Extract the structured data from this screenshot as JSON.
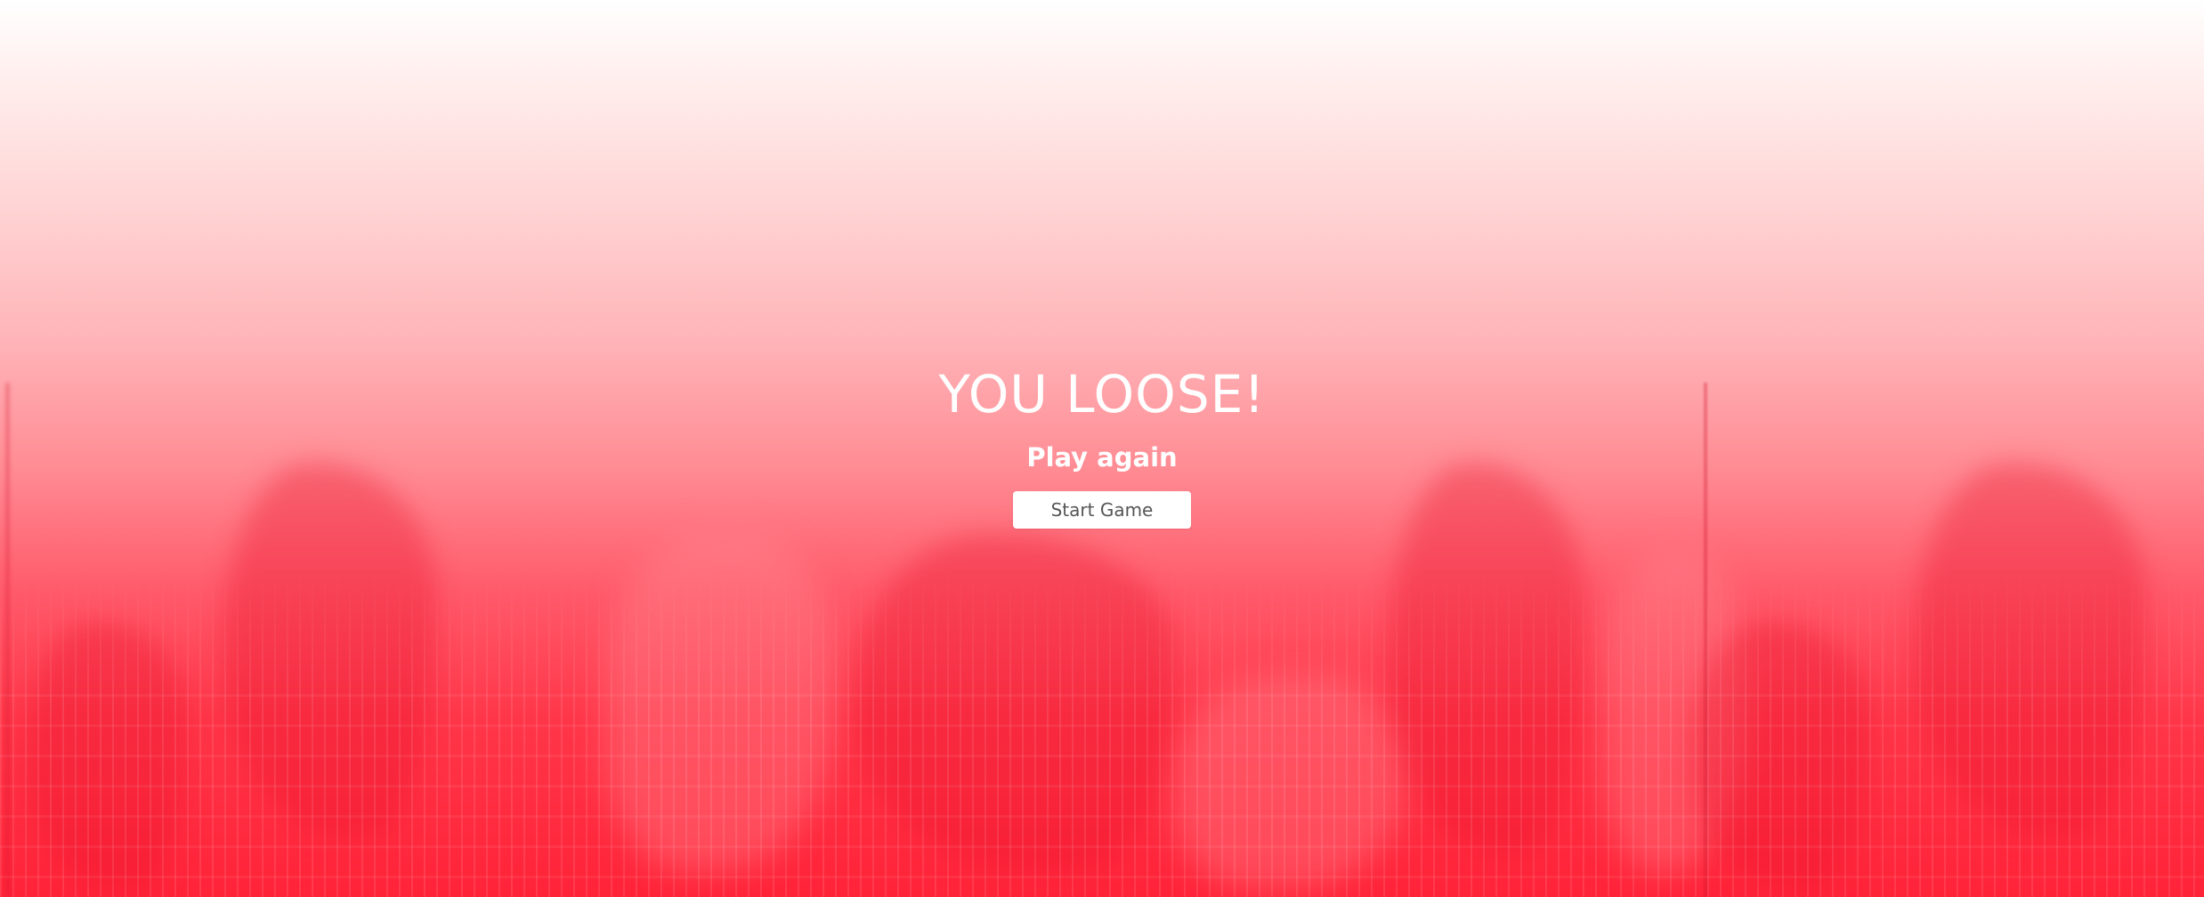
{
  "game_over": {
    "title": "YOU LOOSE!",
    "subtitle": "Play again",
    "start_button_label": "Start Game"
  },
  "theme": {
    "background_top": "#ffffff",
    "background_bottom": "#ff2338",
    "text_color": "#ffffff",
    "button_background": "#ffffff",
    "button_text_color": "#555555"
  }
}
